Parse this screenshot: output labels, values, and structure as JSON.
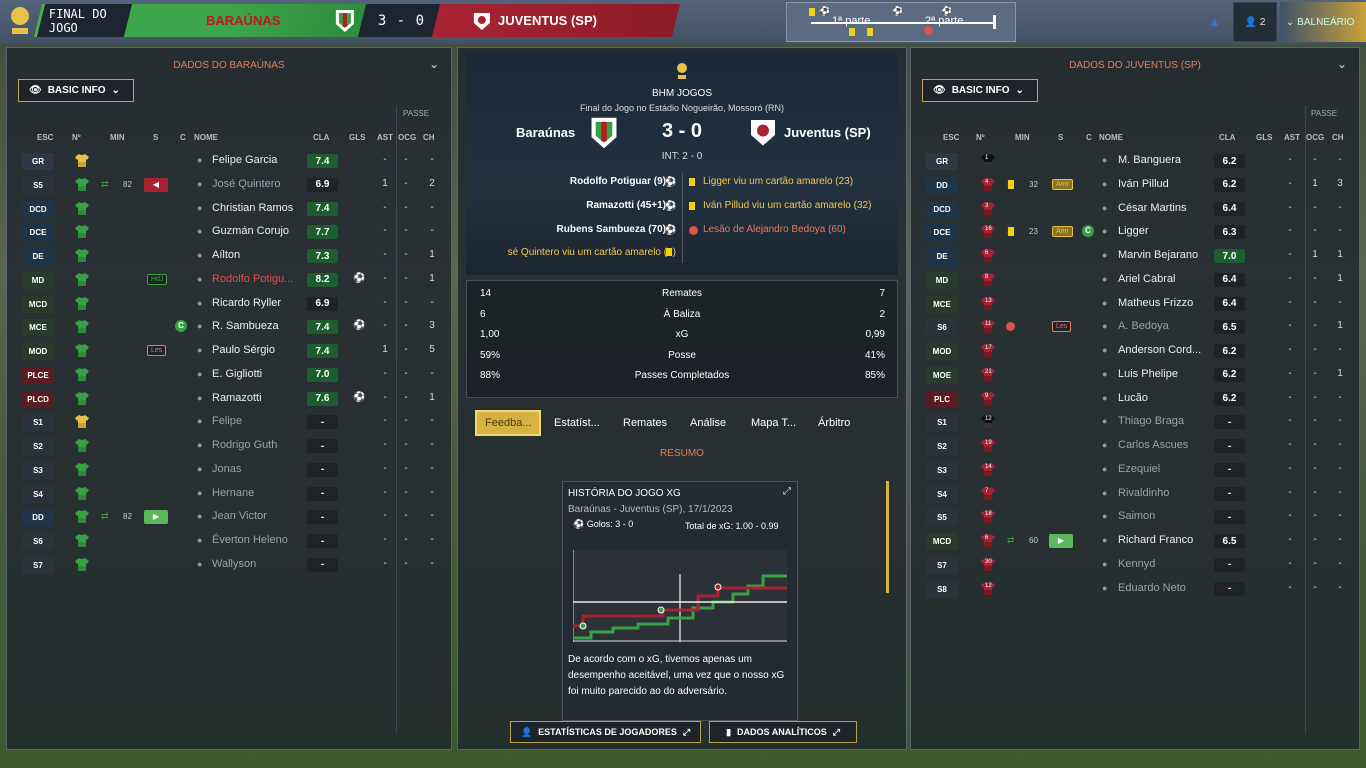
{
  "topbar": {
    "status": "FINAL DO JOGO",
    "home_team": "BARAÚNAS",
    "score": "3 - 0",
    "away_team": "JUVENTUS (SP)",
    "half1": "1ª parte",
    "half2": "2ª parte",
    "people_count": "2",
    "balneario": "BALNEÁRIO"
  },
  "left": {
    "title": "DADOS DO BARAÚNAS",
    "basic_info": "BASIC INFO",
    "passe_label": "PASSE",
    "headers": {
      "esc": "ESC",
      "n": "Nº",
      "min": "MIN",
      "s": "S",
      "c": "C",
      "nome": "NOME",
      "cla": "CLA",
      "gls": "GLS",
      "ast": "AST",
      "ocg": "OCG",
      "ch": "CH"
    },
    "players": [
      {
        "pos": "GR",
        "name": "Felipe Garcia",
        "rating": "7.4",
        "gls": "",
        "ast": "-",
        "ocg": "-",
        "ch": "-"
      },
      {
        "pos": "S5",
        "name": "José Quintero",
        "rating": "6.9",
        "min": "82",
        "gls": "",
        "ast": "1",
        "ocg": "-",
        "ch": "2"
      },
      {
        "pos": "DCD",
        "name": "Christian Ramos",
        "rating": "7.4",
        "gls": "",
        "ast": "-",
        "ocg": "-",
        "ch": "-"
      },
      {
        "pos": "DCE",
        "name": "Guzmán Corujo",
        "rating": "7.7",
        "gls": "",
        "ast": "-",
        "ocg": "-",
        "ch": "-"
      },
      {
        "pos": "DE",
        "name": "Aílton",
        "rating": "7.3",
        "gls": "",
        "ast": "-",
        "ocg": "-",
        "ch": "1"
      },
      {
        "pos": "MD",
        "name": "Rodolfo Potigu...",
        "rating": "8.2",
        "tag": "HdJ",
        "gls": "1",
        "ast": "-",
        "ocg": "-",
        "ch": "1"
      },
      {
        "pos": "MCD",
        "name": "Ricardo Ryller",
        "rating": "6.9",
        "gls": "",
        "ast": "-",
        "ocg": "-",
        "ch": "-"
      },
      {
        "pos": "MCE",
        "name": "R. Sambueza",
        "rating": "7.4",
        "c": "C",
        "gls": "1",
        "ast": "-",
        "ocg": "-",
        "ch": "3"
      },
      {
        "pos": "MOD",
        "name": "Paulo Sérgio",
        "rating": "7.4",
        "tag": "Les",
        "gls": "",
        "ast": "1",
        "ocg": "-",
        "ch": "5"
      },
      {
        "pos": "PLCE",
        "name": "E. Gigliotti",
        "rating": "7.0",
        "gls": "",
        "ast": "-",
        "ocg": "-",
        "ch": "-"
      },
      {
        "pos": "PLCD",
        "name": "Ramazotti",
        "rating": "7.6",
        "gls": "1",
        "ast": "-",
        "ocg": "-",
        "ch": "1"
      },
      {
        "pos": "S1",
        "name": "Felipe",
        "rating": "-",
        "gls": "",
        "ast": "-",
        "ocg": "-",
        "ch": "-"
      },
      {
        "pos": "S2",
        "name": "Rodrigo Guth",
        "rating": "-",
        "gls": "",
        "ast": "-",
        "ocg": "-",
        "ch": "-"
      },
      {
        "pos": "S3",
        "name": "Jonas",
        "rating": "-",
        "gls": "",
        "ast": "-",
        "ocg": "-",
        "ch": "-"
      },
      {
        "pos": "S4",
        "name": "Hernane",
        "rating": "-",
        "gls": "",
        "ast": "-",
        "ocg": "-",
        "ch": "-"
      },
      {
        "pos": "DD",
        "name": "Jean Victor",
        "rating": "-",
        "min": "82",
        "gls": "",
        "ast": "-",
        "ocg": "-",
        "ch": "-"
      },
      {
        "pos": "S6",
        "name": "Éverton Heleno",
        "rating": "-",
        "gls": "",
        "ast": "-",
        "ocg": "-",
        "ch": "-"
      },
      {
        "pos": "S7",
        "name": "Wallyson",
        "rating": "-",
        "gls": "",
        "ast": "-",
        "ocg": "-",
        "ch": "-"
      }
    ]
  },
  "right": {
    "title": "DADOS DO JUVENTUS (SP)",
    "basic_info": "BASIC INFO",
    "passe_label": "PASSE",
    "players": [
      {
        "pos": "GR",
        "num": "1",
        "name": "M. Banguera",
        "rating": "6.2",
        "gls": "",
        "ast": "-",
        "ocg": "-",
        "ch": "-"
      },
      {
        "pos": "DD",
        "num": "4",
        "name": "Iván Pillud",
        "rating": "6.2",
        "min": "32",
        "tag": "Amr",
        "gls": "",
        "ast": "-",
        "ocg": "1",
        "ch": "3"
      },
      {
        "pos": "DCD",
        "num": "3",
        "name": "César Martins",
        "rating": "6.4",
        "gls": "",
        "ast": "-",
        "ocg": "-",
        "ch": "-"
      },
      {
        "pos": "DCE",
        "num": "16",
        "name": "Ligger",
        "rating": "6.3",
        "min": "23",
        "tag": "Amr",
        "c": "C",
        "gls": "",
        "ast": "-",
        "ocg": "-",
        "ch": "-"
      },
      {
        "pos": "DE",
        "num": "6",
        "name": "Marvin Bejarano",
        "rating": "7.0",
        "gls": "",
        "ast": "-",
        "ocg": "1",
        "ch": "1"
      },
      {
        "pos": "MD",
        "num": "8",
        "name": "Ariel Cabral",
        "rating": "6.4",
        "gls": "",
        "ast": "-",
        "ocg": "-",
        "ch": "1"
      },
      {
        "pos": "MCE",
        "num": "13",
        "name": "Matheus Frizzo",
        "rating": "6.4",
        "gls": "",
        "ast": "-",
        "ocg": "-",
        "ch": "-"
      },
      {
        "pos": "S6",
        "num": "11",
        "name": "A. Bedoya",
        "rating": "6.5",
        "tag": "Les",
        "gls": "",
        "ast": "-",
        "ocg": "-",
        "ch": "1"
      },
      {
        "pos": "MOD",
        "num": "17",
        "name": "Anderson Cord...",
        "rating": "6.2",
        "gls": "",
        "ast": "-",
        "ocg": "-",
        "ch": "-"
      },
      {
        "pos": "MOE",
        "num": "21",
        "name": "Luis Phelipe",
        "rating": "6.2",
        "gls": "",
        "ast": "-",
        "ocg": "-",
        "ch": "1"
      },
      {
        "pos": "PLC",
        "num": "9",
        "name": "Lucão",
        "rating": "6.2",
        "gls": "",
        "ast": "-",
        "ocg": "-",
        "ch": "-"
      },
      {
        "pos": "S1",
        "num": "12",
        "name": "Thiago Braga",
        "rating": "-",
        "gls": "",
        "ast": "-",
        "ocg": "-",
        "ch": "-"
      },
      {
        "pos": "S2",
        "num": "19",
        "name": "Carlos Ascues",
        "rating": "-",
        "gls": "",
        "ast": "-",
        "ocg": "-",
        "ch": "-"
      },
      {
        "pos": "S3",
        "num": "14",
        "name": "Ezequiel",
        "rating": "-",
        "gls": "",
        "ast": "-",
        "ocg": "-",
        "ch": "-"
      },
      {
        "pos": "S4",
        "num": "7",
        "name": "Rivaldinho",
        "rating": "-",
        "gls": "",
        "ast": "-",
        "ocg": "-",
        "ch": "-"
      },
      {
        "pos": "S5",
        "num": "18",
        "name": "Saimon",
        "rating": "-",
        "gls": "",
        "ast": "-",
        "ocg": "-",
        "ch": "-"
      },
      {
        "pos": "MCD",
        "num": "6",
        "name": "Richard Franco",
        "rating": "6.5",
        "min": "60",
        "gls": "",
        "ast": "-",
        "ocg": "-",
        "ch": "-"
      },
      {
        "pos": "S7",
        "num": "30",
        "name": "Kennyd",
        "rating": "-",
        "gls": "",
        "ast": "-",
        "ocg": "-",
        "ch": "-"
      },
      {
        "pos": "S8",
        "num": "12",
        "name": "Eduardo Neto",
        "rating": "-",
        "gls": "",
        "ast": "-",
        "ocg": "-",
        "ch": "-"
      }
    ]
  },
  "center": {
    "competition": "BHM JOGOS",
    "subtitle": "Final do Jogo no Estádio Nogueirão, Mossoró (RN)",
    "home": "Baraúnas",
    "away": "Juventus (SP)",
    "score": "3 - 0",
    "interval": "INT: 2 - 0",
    "home_events": [
      "Rodolfo Potiguar (9)",
      "Ramazotti (45+1)",
      "Rubens Sambueza (70)",
      "sé Quintero viu um cartão amarelo (2)"
    ],
    "away_events": [
      "Ligger viu um cartão amarelo (23)",
      "Iván Pillud viu um cartão amarelo (32)",
      "Lesão de Alejandro Bedoya (60)"
    ],
    "stats": [
      {
        "home": "14",
        "label": "Remates",
        "away": "7"
      },
      {
        "home": "6",
        "label": "À Baliza",
        "away": "2"
      },
      {
        "home": "1,00",
        "label": "xG",
        "away": "0,99"
      },
      {
        "home": "59%",
        "label": "Posse",
        "away": "41%"
      },
      {
        "home": "88%",
        "label": "Passes Completados",
        "away": "85%"
      }
    ],
    "tabs": [
      "Feedba...",
      "Estatíst...",
      "Remates",
      "Análise",
      "Mapa T...",
      "Árbitro"
    ],
    "resumo": "RESUMO",
    "card": {
      "title": "HISTÓRIA DO JOGO XG",
      "sub": "Baraúnas - Juventus (SP), 17/1/2023",
      "goals": "Golos: 3 - 0",
      "xg_total": "Total de xG: 1.00 - 0.99",
      "text": "De acordo com o xG, tivemos apenas um desempenho aceitável, uma vez que o nosso xG foi muito parecido ao do adversário."
    },
    "btn_players": "ESTATÍSTICAS DE JOGADORES",
    "btn_analytics": "DADOS ANALÍTICOS"
  }
}
